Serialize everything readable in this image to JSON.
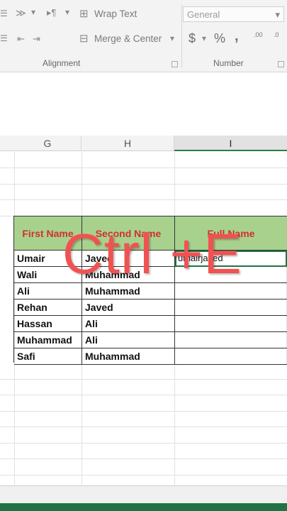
{
  "ribbon": {
    "wrap_text_label": "Wrap Text",
    "merge_center_label": "Merge & Center",
    "number_format_value": "General",
    "currency_symbol": "$",
    "percent_symbol": "%",
    "comma_symbol": ",",
    "increase_decimal_label": ".00",
    "decrease_decimal_label": ".0",
    "alignment_group_label": "Alignment",
    "number_group_label": "Number"
  },
  "columns": [
    {
      "letter": "G"
    },
    {
      "letter": "H"
    },
    {
      "letter": "I"
    }
  ],
  "table": {
    "headers": [
      "First Name",
      "Second Name",
      "Full Name"
    ],
    "rows": [
      {
        "first": "Umair",
        "second": "Javed",
        "full": "umairjaved"
      },
      {
        "first": "Wali",
        "second": "Muhammad",
        "full": ""
      },
      {
        "first": "Ali",
        "second": "Muhammad",
        "full": ""
      },
      {
        "first": "Rehan",
        "second": "Javed",
        "full": ""
      },
      {
        "first": "Hassan",
        "second": "Ali",
        "full": ""
      },
      {
        "first": "Muhammad",
        "second": "Ali",
        "full": ""
      },
      {
        "first": "Safi",
        "second": "Muhammad",
        "full": ""
      }
    ]
  },
  "overlay": {
    "shortcut_text": "Ctrl +E"
  },
  "colors": {
    "header_fill": "#a9d18e",
    "header_text": "#d0312d",
    "overlay_text": "#f05252",
    "excel_green": "#217346"
  }
}
